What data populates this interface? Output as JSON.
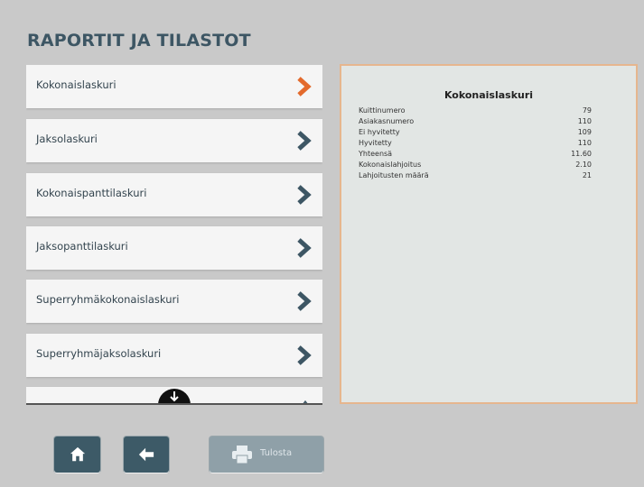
{
  "page": {
    "title": "RAPORTIT JA TILASTOT"
  },
  "report_list": {
    "items": [
      {
        "label": "Kokonaislaskuri",
        "selected": true
      },
      {
        "label": "Jaksolaskuri",
        "selected": false
      },
      {
        "label": "Kokonaispanttilaskuri",
        "selected": false
      },
      {
        "label": "Jaksopanttilaskuri",
        "selected": false
      },
      {
        "label": "Superryhmäkokonaislaskuri",
        "selected": false
      },
      {
        "label": "Superryhmäjaksolaskuri",
        "selected": false
      },
      {
        "label": "",
        "selected": false
      }
    ]
  },
  "report": {
    "heading": "Kokonaislaskuri",
    "rows": [
      {
        "label": "Kuittinumero",
        "value": "79"
      },
      {
        "label": "Asiakasnumero",
        "value": "110"
      },
      {
        "label": "Ei hyvitetty",
        "value": "109"
      },
      {
        "label": "Hyvitetty",
        "value": "110"
      },
      {
        "label": "Yhteensä",
        "value": "11.60"
      },
      {
        "label": "Kokonaislahjoitus",
        "value": "2.10"
      },
      {
        "label": "Lahjoitusten määrä",
        "value": "21"
      }
    ]
  },
  "toolbar": {
    "home_icon": "home-icon",
    "back_icon": "arrow-left-icon",
    "print_icon": "printer-icon",
    "print_label": "Tulosta"
  },
  "colors": {
    "accent_orange": "#e36a2c",
    "chevron_dark": "#3d5664",
    "button_bg": "#3d5a67",
    "panel_border": "#e6b68e"
  }
}
